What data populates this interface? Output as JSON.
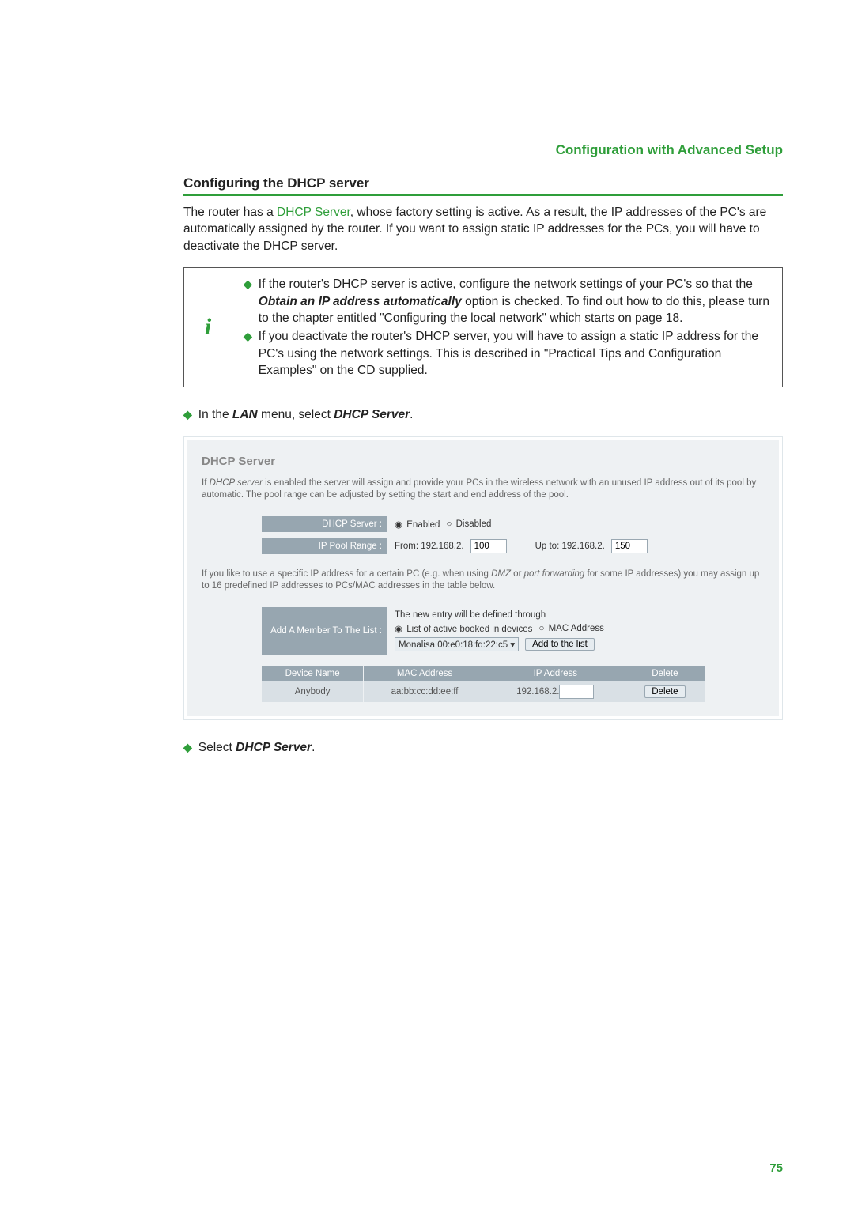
{
  "heading": "Configuration with Advanced Setup",
  "section_title": "Configuring the DHCP server",
  "intro_text_pre": "The router has a ",
  "intro_link": "DHCP Server",
  "intro_text_post": ", whose factory setting is active. As a result, the IP addresses of the PC's are automatically assigned by the router. If you want to assign static IP addresses for the PCs, you will have to deactivate the DHCP server.",
  "note_icon": "i",
  "note_items": [
    {
      "pre": "If the router's DHCP server is active, configure the network settings of your PC's so that the ",
      "bold": "Obtain an IP address automatically",
      "post": " option is checked. To find out how to do this, please turn to the chapter entitled \"Configuring the local network\" which starts on page 18."
    },
    {
      "pre": "If you deactivate the router's DHCP server, you will have to assign a static IP address for the PC's using the network settings. This is described in \"Practical Tips and Configuration Examples\" on the CD supplied.",
      "bold": "",
      "post": ""
    }
  ],
  "step1_pre": "In the ",
  "step1_b1": "LAN",
  "step1_mid": " menu, select ",
  "step1_b2": "DHCP Server",
  "step1_post": ".",
  "shot": {
    "title": "DHCP Server",
    "desc_pre": "If ",
    "desc_it1": "DHCP server",
    "desc_mid": " is enabled the server will assign and provide your PCs in the wireless network with an unused IP address out of its pool by automatic. The pool range can be adjusted by setting the start and end address of the pool.",
    "labels": {
      "dhcp_server": "DHCP Server :",
      "ip_pool": "IP Pool Range :",
      "add_member": "Add A Member To The List :"
    },
    "enabled": "Enabled",
    "disabled": "Disabled",
    "pool_from": "From: 192.168.2.",
    "pool_from_val": "100",
    "pool_to": "Up to: 192.168.2.",
    "pool_to_val": "150",
    "desc2_pre": "If you like to use a specific IP address for a certain PC (e.g. when using ",
    "desc2_it1": "DMZ",
    "desc2_mid1": " or ",
    "desc2_it2": "port forwarding",
    "desc2_post": " for some IP addresses) you may assign up to 16 predefined IP addresses to PCs/MAC addresses in the table below.",
    "add_line1": "The new entry will be defined through",
    "add_opt1": "List of active booked in devices",
    "add_opt2": "MAC Address",
    "add_device": "Monalisa 00:e0:18:fd:22:c5",
    "add_btn": "Add to the list",
    "table": {
      "headers": [
        "Device Name",
        "MAC Address",
        "IP Address",
        "Delete"
      ],
      "row": {
        "name": "Anybody",
        "mac": "aa:bb:cc:dd:ee:ff",
        "ip_prefix": "192.168.2.",
        "ip_val": "",
        "del": "Delete"
      }
    }
  },
  "step2_pre": "Select ",
  "step2_b": "DHCP Server",
  "step2_post": ".",
  "page_number": "75"
}
